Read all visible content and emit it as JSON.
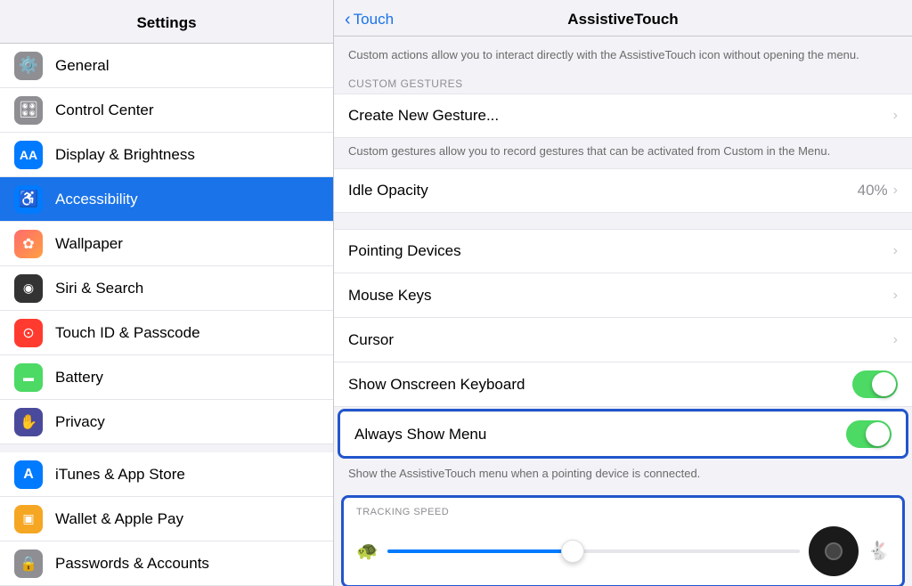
{
  "sidebar": {
    "title": "Settings",
    "items": [
      {
        "id": "general",
        "label": "General",
        "icon": "⚙️",
        "bg": "#8e8e93",
        "active": false
      },
      {
        "id": "control-center",
        "label": "Control Center",
        "icon": "🎛",
        "bg": "#8e8e93",
        "active": false
      },
      {
        "id": "display-brightness",
        "label": "Display & Brightness",
        "icon": "AA",
        "bg": "#007aff",
        "active": false
      },
      {
        "id": "accessibility",
        "label": "Accessibility",
        "icon": "♿",
        "bg": "#007aff",
        "active": true
      },
      {
        "id": "wallpaper",
        "label": "Wallpaper",
        "icon": "❋",
        "bg": "#ff6b6b",
        "active": false
      },
      {
        "id": "siri-search",
        "label": "Siri & Search",
        "icon": "◉",
        "bg": "#333",
        "active": false
      },
      {
        "id": "touch-id",
        "label": "Touch ID & Passcode",
        "icon": "◎",
        "bg": "#ff3b30",
        "active": false
      },
      {
        "id": "battery",
        "label": "Battery",
        "icon": "▬",
        "bg": "#4cd964",
        "active": false
      },
      {
        "id": "privacy",
        "label": "Privacy",
        "icon": "✋",
        "bg": "#4a4a9c",
        "active": false
      },
      {
        "id": "itunes",
        "label": "iTunes & App Store",
        "icon": "A",
        "bg": "#007aff",
        "active": false
      },
      {
        "id": "wallet",
        "label": "Wallet & Apple Pay",
        "icon": "▣",
        "bg": "#f5a623",
        "active": false
      },
      {
        "id": "passwords",
        "label": "Passwords & Accounts",
        "icon": "🔒",
        "bg": "#8e8e93",
        "active": false
      }
    ]
  },
  "nav": {
    "back_label": "Touch",
    "title": "AssistiveTouch"
  },
  "content": {
    "top_description": "Custom actions allow you to interact directly with the AssistiveTouch icon without opening the menu.",
    "sections": [
      {
        "header": "CUSTOM GESTURES",
        "rows": [
          {
            "label": "Create New Gesture...",
            "value": "",
            "has_chevron": true,
            "toggle": false
          }
        ],
        "footer": "Custom gestures allow you to record gestures that can be activated from Custom in the Menu."
      }
    ],
    "idle_opacity_label": "Idle Opacity",
    "idle_opacity_value": "40%",
    "pointing_devices_label": "Pointing Devices",
    "mouse_keys_label": "Mouse Keys",
    "cursor_label": "Cursor",
    "show_onscreen_label": "Show Onscreen Keyboard",
    "always_show_label": "Always Show Menu",
    "always_show_footer": "Show the AssistiveTouch menu when a pointing device is connected.",
    "tracking_header": "TRACKING SPEED",
    "tracking_turtle_icon": "🐢",
    "tracking_rabbit_icon": "🐇"
  }
}
